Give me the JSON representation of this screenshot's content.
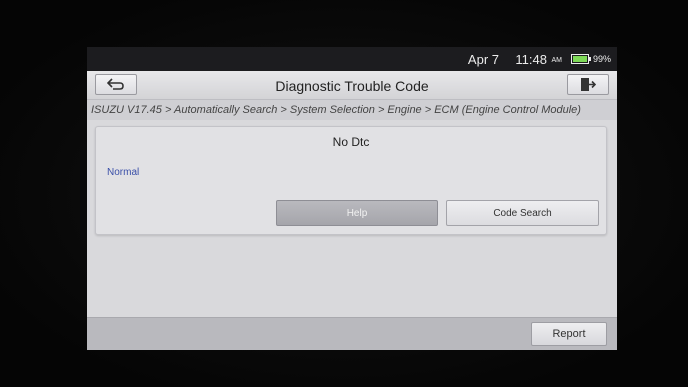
{
  "status_bar": {
    "date": "Apr 7",
    "time": "11:48",
    "ampm": "AM",
    "battery": "99%"
  },
  "header": {
    "title": "Diagnostic Trouble Code",
    "back_icon": "back-arrow-icon",
    "exit_icon": "exit-door-icon"
  },
  "breadcrumb": "ISUZU V17.45 > Automatically Search > System Selection > Engine > ECM (Engine Control Module)",
  "result": {
    "message": "No Dtc",
    "status": "Normal",
    "help_label": "Help",
    "code_search_label": "Code Search"
  },
  "footer": {
    "report_label": "Report"
  },
  "colors": {
    "status_text": "#3a4fa8",
    "battery": "#7ed957"
  }
}
